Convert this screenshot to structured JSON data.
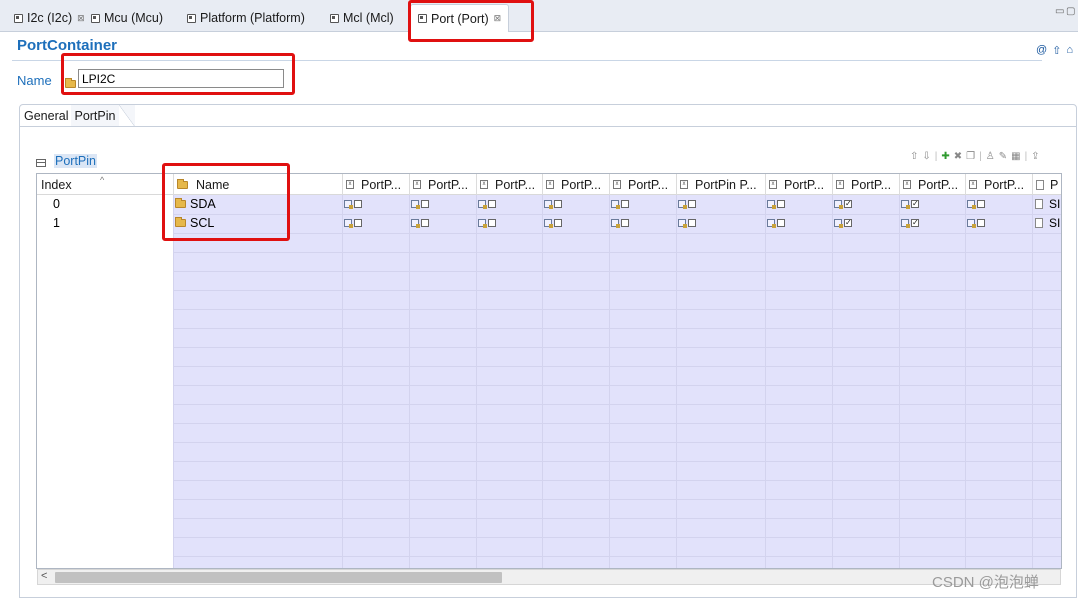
{
  "tabs": [
    {
      "label": "I2c (I2c)",
      "active": false,
      "closable": true
    },
    {
      "label": "Mcu (Mcu)",
      "active": false,
      "closable": false
    },
    {
      "label": "Platform (Platform)",
      "active": false,
      "closable": false
    },
    {
      "label": "Mcl (Mcl)",
      "active": false,
      "closable": false
    },
    {
      "label": "Port (Port)",
      "active": true,
      "closable": true
    }
  ],
  "window_controls": {
    "minimize": "▭",
    "maximize": "▢"
  },
  "form": {
    "title": "PortContainer",
    "name_label": "Name",
    "name_value": "LPI2C"
  },
  "subtabs": [
    "General",
    "PortPin"
  ],
  "section": {
    "title": "PortPin"
  },
  "table": {
    "columns": [
      "Index",
      "Name",
      "PortP...",
      "PortP...",
      "PortP...",
      "PortP...",
      "PortP...",
      "PortPin P...",
      "PortP...",
      "PortP...",
      "PortP...",
      "PortP...",
      "P"
    ],
    "rows": [
      {
        "index": "0",
        "name": "SDA",
        "checks": [
          false,
          false,
          false,
          false,
          false,
          false,
          false,
          true,
          true,
          false
        ],
        "last": "SIU"
      },
      {
        "index": "1",
        "name": "SCL",
        "checks": [
          false,
          false,
          false,
          false,
          false,
          false,
          false,
          true,
          true,
          false
        ],
        "last": "SIU"
      }
    ]
  },
  "watermark": "CSDN @泡泡蝉",
  "colors": {
    "accent": "#1d6fbb",
    "highlight": "#e01010",
    "row_fill": "#e2e2fb"
  }
}
